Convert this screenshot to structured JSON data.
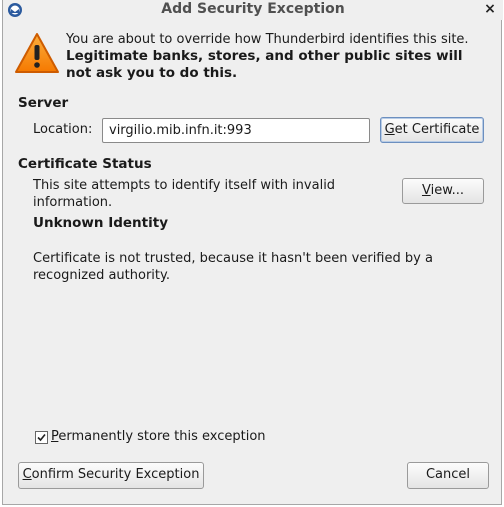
{
  "window": {
    "title": "Add Security Exception",
    "close_glyph": "×"
  },
  "intro": {
    "line": "You are about to override how Thunderbird identifies this site.",
    "bold_warning": "Legitimate banks, stores, and other public sites will not ask you to do this."
  },
  "server": {
    "heading": "Server",
    "location_label": "Location:",
    "location_value": "virgilio.mib.infn.it:993",
    "get_certificate_mnemonic": "G",
    "get_certificate_rest": "et Certificate"
  },
  "certificate_status": {
    "heading": "Certificate Status",
    "invalid_text": "This site attempts to identify itself with invalid information.",
    "view_mnemonic": "V",
    "view_rest": "iew...",
    "unknown_heading": "Unknown Identity",
    "unknown_text": "Certificate is not trusted, because it hasn't been verified by a recognized authority."
  },
  "permanent": {
    "checked": true,
    "mnemonic": "P",
    "label_rest": "ermanently store this exception"
  },
  "footer": {
    "confirm_mnemonic": "C",
    "confirm_rest": "onfirm Security Exception",
    "cancel_label": "Cancel"
  },
  "icons": {
    "app": "thunderbird-icon",
    "warning": "warning-triangle-icon",
    "close": "close-icon",
    "check": "checkmark-icon"
  },
  "colors": {
    "warning_fill": "#f57900",
    "window_bg": "#efefef",
    "focus_border": "#6c8fbf"
  }
}
